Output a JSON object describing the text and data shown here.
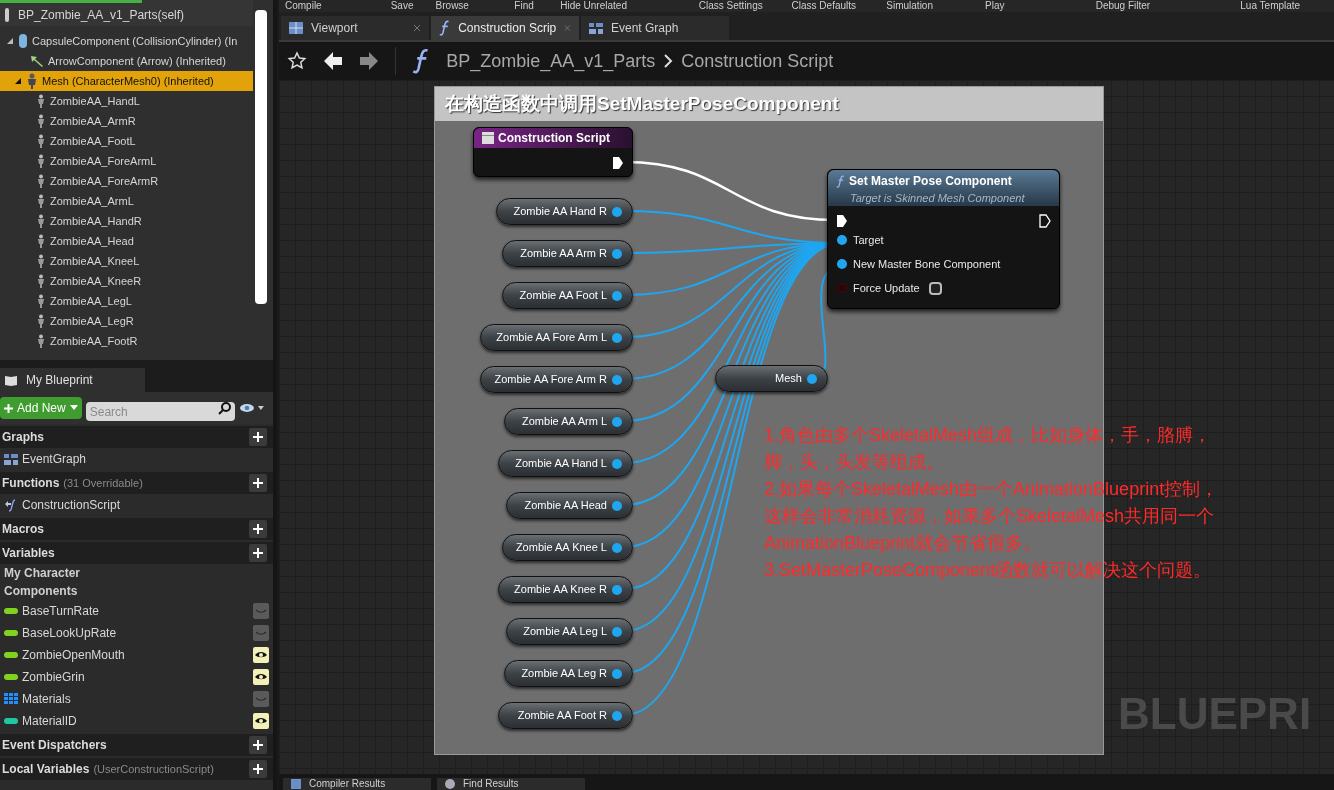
{
  "toolbar": {
    "buttons": [
      "Compile",
      "Save",
      "Browse",
      "Find",
      "Hide Unrelated",
      "Class Settings",
      "Class Defaults",
      "Simulation",
      "Play",
      "Debug Filter",
      "Lua Template"
    ]
  },
  "components": {
    "root": "BP_Zombie_AA_v1_Parts(self)",
    "tree": [
      {
        "label": "CapsuleComponent (CollisionCylinder) (In",
        "kind": "capsule",
        "expanded": true,
        "selected": false,
        "children": [
          {
            "label": "ArrowComponent (Arrow) (Inherited)",
            "kind": "arrow",
            "selected": false
          },
          {
            "label": "Mesh (CharacterMesh0) (Inherited)",
            "kind": "mesh",
            "expanded": true,
            "selected": true,
            "children": [
              {
                "label": "ZombieAA_HandL",
                "kind": "part",
                "selected": false
              },
              {
                "label": "ZombieAA_ArmR",
                "kind": "part",
                "selected": false
              },
              {
                "label": "ZombieAA_FootL",
                "kind": "part",
                "selected": false
              },
              {
                "label": "ZombieAA_ForeArmL",
                "kind": "part",
                "selected": false
              },
              {
                "label": "ZombieAA_ForeArmR",
                "kind": "part",
                "selected": false
              },
              {
                "label": "ZombieAA_ArmL",
                "kind": "part",
                "selected": false
              },
              {
                "label": "ZombieAA_HandR",
                "kind": "part",
                "selected": false
              },
              {
                "label": "ZombieAA_Head",
                "kind": "part",
                "selected": false
              },
              {
                "label": "ZombieAA_KneeL",
                "kind": "part",
                "selected": false
              },
              {
                "label": "ZombieAA_KneeR",
                "kind": "part",
                "selected": false
              },
              {
                "label": "ZombieAA_LegL",
                "kind": "part",
                "selected": false
              },
              {
                "label": "ZombieAA_LegR",
                "kind": "part",
                "selected": false
              },
              {
                "label": "ZombieAA_FootR",
                "kind": "part",
                "selected": false
              }
            ]
          }
        ]
      }
    ]
  },
  "my_blueprint": {
    "tab": "My Blueprint",
    "add_new": "Add New",
    "search": {
      "placeholder": "Search"
    },
    "sections": [
      {
        "title": "Graphs",
        "items": [
          {
            "label": "EventGraph",
            "kind": "graph"
          }
        ]
      },
      {
        "title": "Functions",
        "note": "(31 Overridable)",
        "items": [
          {
            "label": "ConstructionScript",
            "kind": "function"
          }
        ]
      },
      {
        "title": "Macros"
      },
      {
        "title": "Variables",
        "items": [
          {
            "label": "My Character",
            "kind": "category"
          },
          {
            "label": "Components",
            "kind": "category"
          },
          {
            "label": "BaseTurnRate",
            "kind": "variable",
            "color": "#7ed321",
            "visible": false
          },
          {
            "label": "BaseLookUpRate",
            "kind": "variable",
            "color": "#7ed321",
            "visible": false
          },
          {
            "label": "ZombieOpenMouth",
            "kind": "variable",
            "color": "#7ed321",
            "visible": true
          },
          {
            "label": "ZombieGrin",
            "kind": "variable",
            "color": "#7ed321",
            "visible": true
          },
          {
            "label": "Materials",
            "kind": "array",
            "color": "#1e90ff",
            "visible": false
          },
          {
            "label": "MaterialID",
            "kind": "variable",
            "color": "#1fc8a0",
            "visible": true
          }
        ]
      },
      {
        "title": "Event Dispatchers"
      },
      {
        "title": "Local Variables",
        "note": "(UserConstructionScript)"
      }
    ]
  },
  "graph_tabs": [
    {
      "label": "Viewport",
      "kind": "viewport",
      "selected": false
    },
    {
      "label": "Construction Scrip",
      "kind": "function",
      "selected": true
    },
    {
      "label": "Event Graph",
      "kind": "graph",
      "selected": false
    }
  ],
  "breadcrumb": [
    "BP_Zombie_AA_v1_Parts",
    "Construction Script"
  ],
  "graph": {
    "comment": "在构造函数中调用SetMasterPoseComponent",
    "event_node": {
      "title": "Construction Script"
    },
    "references": [
      "Zombie AA Hand R",
      "Zombie AA Arm R",
      "Zombie AA Foot L",
      "Zombie AA Fore Arm L",
      "Zombie AA Fore Arm R",
      "Zombie AA Arm L",
      "Zombie AA Hand L",
      "Zombie AA Head",
      "Zombie AA Knee L",
      "Zombie AA Knee R",
      "Zombie AA Leg L",
      "Zombie AA Leg R",
      "Zombie AA Foot R"
    ],
    "mesh_node": "Mesh",
    "function_node": {
      "title": "Set Master Pose Component",
      "subtitle": "Target is Skinned Mesh Component",
      "pins": [
        {
          "label": "Target",
          "kind": "object"
        },
        {
          "label": "New Master Bone Component",
          "kind": "object"
        },
        {
          "label": "Force Update",
          "kind": "bool",
          "checked": false
        }
      ]
    },
    "annotation": [
      "1.角色由多个SkeletalMesh组成，比如身体，手，胳膊，",
      "脚，头，头发等组成。",
      "2.如果每个SkeletalMesh由一个AnimationBlueprint控制，",
      "这样会非常消耗资源，如果多个SkeletalMesh共用同一个",
      "AnimationBlueprint就会节省很多。",
      "3.SetMasterPoseComponent函数就可以解决这个问题。"
    ],
    "watermark": "BLUEPRI"
  },
  "bottom_tabs": [
    "Compiler Results",
    "Find Results"
  ]
}
